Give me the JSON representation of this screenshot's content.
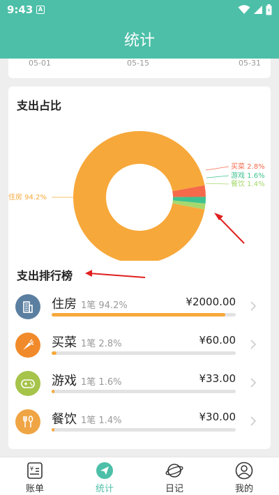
{
  "status_bar": {
    "time": "9:43",
    "notification_glyph": "A"
  },
  "header": {
    "title": "统计"
  },
  "trend_axis": {
    "dates": [
      "05-01",
      "05-15",
      "05-31"
    ]
  },
  "expense_share": {
    "title": "支出占比",
    "labels": [
      {
        "name": "住房",
        "percent_text": "94.2%",
        "color": "#f7a83a"
      },
      {
        "name": "买菜",
        "percent_text": "2.8%",
        "color": "#f56a4a"
      },
      {
        "name": "游戏",
        "percent_text": "1.6%",
        "color": "#3ec28f"
      },
      {
        "name": "餐饮",
        "percent_text": "1.4%",
        "color": "#a6d86e"
      }
    ]
  },
  "chart_data": {
    "type": "pie",
    "categories": [
      "住房",
      "买菜",
      "游戏",
      "餐饮"
    ],
    "values": [
      94.2,
      2.8,
      1.6,
      1.4
    ],
    "colors": [
      "#f7a83a",
      "#f56a4a",
      "#3ec28f",
      "#a6d86e"
    ]
  },
  "ranking": {
    "title": "支出排行榜",
    "items": [
      {
        "name": "住房",
        "count_text": "1笔",
        "percent_text": "94.2%",
        "amount": "¥2000.00",
        "percent": 94.2,
        "icon": "building-icon",
        "icon_color": "#5b7fa0"
      },
      {
        "name": "买菜",
        "count_text": "1笔",
        "percent_text": "2.8%",
        "amount": "¥60.00",
        "percent": 2.8,
        "icon": "carrot-icon",
        "icon_color": "#f08a2a"
      },
      {
        "name": "游戏",
        "count_text": "1笔",
        "percent_text": "1.6%",
        "amount": "¥33.00",
        "percent": 1.6,
        "icon": "gamepad-icon",
        "icon_color": "#a6c44a"
      },
      {
        "name": "餐饮",
        "count_text": "1笔",
        "percent_text": "1.4%",
        "amount": "¥30.00",
        "percent": 1.4,
        "icon": "utensils-icon",
        "icon_color": "#f0a545"
      }
    ]
  },
  "bottom_nav": {
    "items": [
      {
        "label": "账单",
        "icon": "bill-icon",
        "active": false
      },
      {
        "label": "统计",
        "icon": "send-icon",
        "active": true
      },
      {
        "label": "日记",
        "icon": "planet-icon",
        "active": false
      },
      {
        "label": "我的",
        "icon": "user-icon",
        "active": false
      }
    ]
  },
  "colors": {
    "accent": "#4dbfa8",
    "arrow": "#e02020"
  }
}
